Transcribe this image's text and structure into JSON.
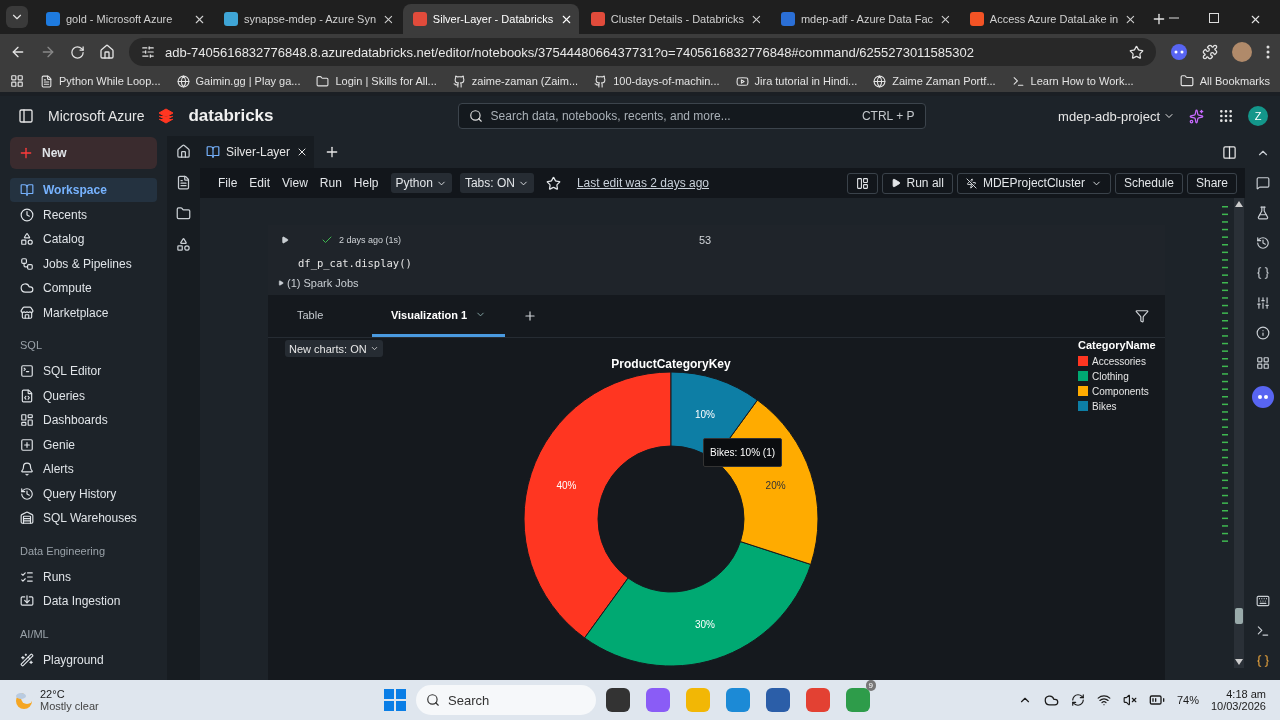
{
  "browser": {
    "tabs": [
      {
        "title": "gold - Microsoft Azure",
        "selected": false
      },
      {
        "title": "synapse-mdep - Azure Syn",
        "selected": false
      },
      {
        "title": "Silver-Layer - Databricks",
        "selected": true
      },
      {
        "title": "Cluster Details - Databricks",
        "selected": false
      },
      {
        "title": "mdep-adf - Azure Data Fac",
        "selected": false
      },
      {
        "title": "Access Azure DataLake in",
        "selected": false
      }
    ],
    "url": "adb-7405616832776848.8.azuredatabricks.net/editor/notebooks/3754448066437731?o=7405616832776848#command/6255273011585302",
    "bookmarks": [
      "Python While Loop...",
      "Gaimin.gg | Play ga...",
      "Login | Skills for All...",
      "zaime-zaman (Zaim...",
      "100-days-of-machin...",
      "Jira tutorial in Hindi...",
      "Zaime Zaman Portf...",
      "Learn How to Work..."
    ],
    "all_bookmarks": "All Bookmarks"
  },
  "header": {
    "brand": "Microsoft Azure",
    "product": "databricks",
    "search": {
      "placeholder": "Search data, notebooks, recents, and more...",
      "shortcut": "CTRL + P"
    },
    "workspace": "mdep-adb-project",
    "avatar": "Z"
  },
  "sidebar": {
    "new_button": "New",
    "sections": [
      {
        "items": [
          {
            "label": "Workspace",
            "selected": true
          },
          {
            "label": "Recents",
            "selected": false
          },
          {
            "label": "Catalog",
            "selected": false
          },
          {
            "label": "Jobs & Pipelines",
            "selected": false
          },
          {
            "label": "Compute",
            "selected": false
          },
          {
            "label": "Marketplace",
            "selected": false
          }
        ]
      },
      {
        "title": "SQL",
        "items": [
          {
            "label": "SQL Editor",
            "selected": false
          },
          {
            "label": "Queries",
            "selected": false
          },
          {
            "label": "Dashboards",
            "selected": false
          },
          {
            "label": "Genie",
            "selected": false
          },
          {
            "label": "Alerts",
            "selected": false
          },
          {
            "label": "Query History",
            "selected": false
          },
          {
            "label": "SQL Warehouses",
            "selected": false
          }
        ]
      },
      {
        "title": "Data Engineering",
        "items": [
          {
            "label": "Runs",
            "selected": false
          },
          {
            "label": "Data Ingestion",
            "selected": false
          }
        ]
      },
      {
        "title": "AI/ML",
        "items": [
          {
            "label": "Playground",
            "selected": false
          }
        ]
      }
    ]
  },
  "notebook": {
    "tab": "Silver-Layer",
    "menu": [
      "File",
      "Edit",
      "View",
      "Run",
      "Help"
    ],
    "language": "Python",
    "tabs_toggle": "Tabs: ON",
    "last_edit": "Last edit was 2 days ago",
    "run_all": "Run all",
    "cluster": "MDEProjectCluster",
    "schedule": "Schedule",
    "share": "Share",
    "cell": {
      "status": "2 days ago (1s)",
      "number": "53",
      "code": "df_p_cat.display()",
      "spark_jobs": "(1) Spark Jobs",
      "output_tabs": [
        {
          "label": "Table",
          "selected": false
        },
        {
          "label": "Visualization 1",
          "selected": true
        }
      ],
      "new_charts": "New charts: ON",
      "tooltip": "Bikes: 10% (1)",
      "chart_data": {
        "type": "donut",
        "title": "ProductCategoryKey",
        "categories": [
          "Accessories",
          "Clothing",
          "Components",
          "Bikes"
        ],
        "colors": [
          "#ff3621",
          "#00a972",
          "#ffab00",
          "#0d7ea5"
        ],
        "values": [
          40,
          30,
          20,
          10
        ],
        "legend": {
          "title": "CategoryName"
        },
        "value_labels": [
          "40%",
          "30%",
          "20%",
          "10%"
        ]
      }
    }
  },
  "taskbar": {
    "weather": {
      "temp": "22°C",
      "condition": "Mostly clear"
    },
    "search": {
      "placeholder": "Search"
    },
    "badge": "9",
    "battery": "74%",
    "time": "4:18 am",
    "date": "10/03/2026"
  }
}
